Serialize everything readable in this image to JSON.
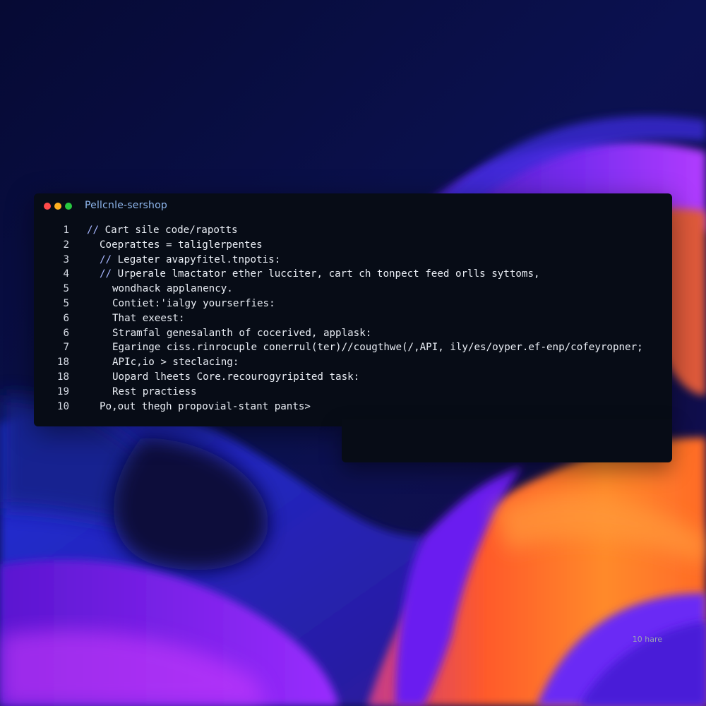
{
  "window": {
    "title": "Pellcnle-sershop",
    "status_text": "10 hare"
  },
  "code_lines": [
    {
      "number": "1",
      "indent": 0,
      "marker": "//",
      "text": "Cart sile code/rapotts"
    },
    {
      "number": "2",
      "indent": 1,
      "marker": "",
      "text": "Coeprattes = taliglerpentes"
    },
    {
      "number": "3",
      "indent": 1,
      "marker": "//",
      "text": "Legater avapyfitel.tnpotis:"
    },
    {
      "number": "4",
      "indent": 1,
      "marker": "//",
      "text": "Urperale lmactator ether lucciter, cart ch tonpect feed orlls syttoms,"
    },
    {
      "number": "5",
      "indent": 2,
      "marker": "",
      "text": "wondhack applanency."
    },
    {
      "number": "5",
      "indent": 2,
      "marker": "",
      "text": "Contiet:'ialgy yourserfies:"
    },
    {
      "number": "6",
      "indent": 2,
      "marker": "",
      "text": "That exeest:"
    },
    {
      "number": "6",
      "indent": 2,
      "marker": "",
      "text": "Stramfal genesalanth of cocerived, applask:"
    },
    {
      "number": "7",
      "indent": 2,
      "marker": "",
      "text": "Egaringe ciss.rinrocuple conerrul(ter)//cougthwe(/,API, ily/es/oyper.ef-enp/cofeyropner;"
    },
    {
      "number": "18",
      "indent": 2,
      "marker": "",
      "text": "APIc,io > steclacing:"
    },
    {
      "number": "18",
      "indent": 2,
      "marker": "",
      "text": "Uopard lheets Core.recourogyripited task:"
    },
    {
      "number": "19",
      "indent": 2,
      "marker": "",
      "text": "Rest practiess"
    },
    {
      "number": "10",
      "indent": 1,
      "marker": "",
      "text": "Po,out thegh propovial-stant pants>"
    }
  ],
  "colors": {
    "editor_bg": "#070c16",
    "comment": "#a8b7ff",
    "title_text": "#8fb7ee"
  }
}
